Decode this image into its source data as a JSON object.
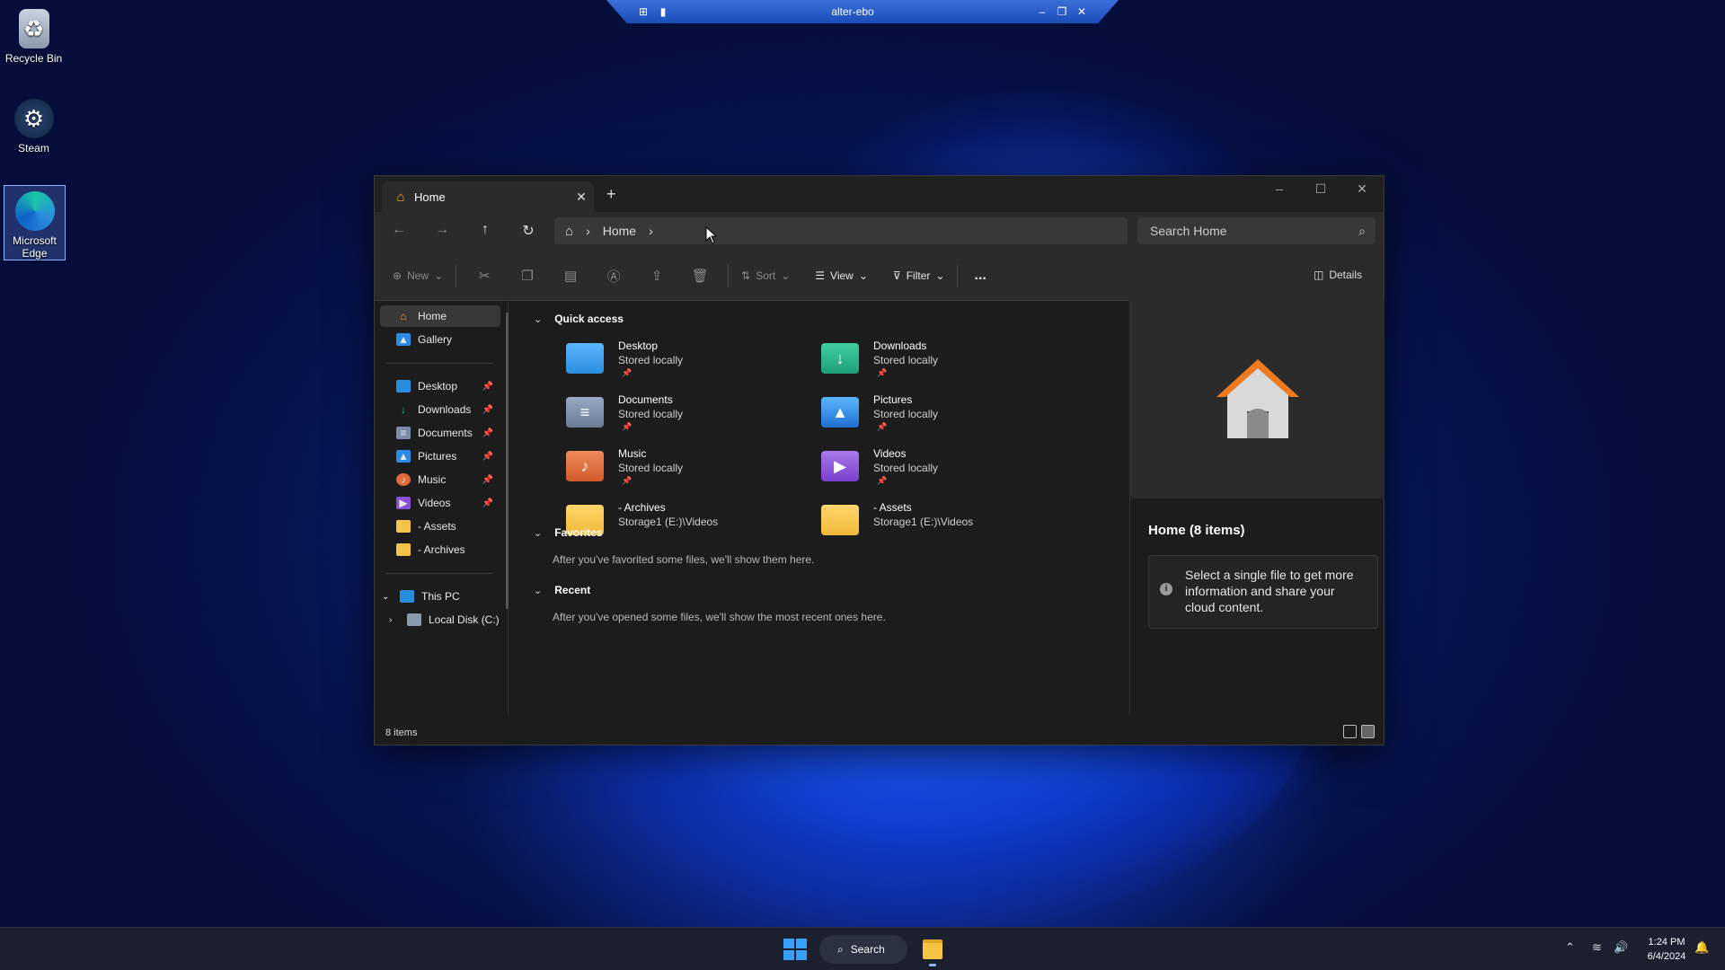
{
  "desktop": {
    "icons": [
      {
        "label": "Recycle Bin"
      },
      {
        "label": "Steam"
      },
      {
        "label": "Microsoft Edge"
      }
    ]
  },
  "remote_bar": {
    "title": "alter-ebo"
  },
  "explorer": {
    "tab_label": "Home",
    "new_tab": "+",
    "breadcrumb": [
      "Home"
    ],
    "search_placeholder": "Search Home",
    "toolbar": {
      "new": "New",
      "sort": "Sort",
      "view": "View",
      "filter": "Filter",
      "more": "...",
      "details": "Details"
    },
    "sidebar": {
      "top": [
        {
          "label": "Home",
          "selected": true
        },
        {
          "label": "Gallery"
        }
      ],
      "pinned": [
        {
          "label": "Desktop"
        },
        {
          "label": "Downloads"
        },
        {
          "label": "Documents"
        },
        {
          "label": "Pictures"
        },
        {
          "label": "Music"
        },
        {
          "label": "Videos"
        },
        {
          "label": "- Assets"
        },
        {
          "label": "- Archives"
        }
      ],
      "this_pc": "This PC",
      "local_disk": "Local Disk (C:)"
    },
    "sections": {
      "quick_access": "Quick access",
      "favorites": "Favorites",
      "favorites_note": "After you've favorited some files, we'll show them here.",
      "recent": "Recent",
      "recent_note": "After you've opened some files, we'll show the most recent ones here."
    },
    "quick_access_items": [
      {
        "name": "Desktop",
        "sub": "Stored locally",
        "color": "#2a8de0"
      },
      {
        "name": "Downloads",
        "sub": "Stored locally",
        "color": "#1f9e7a"
      },
      {
        "name": "Documents",
        "sub": "Stored locally",
        "color": "#7b8ca8"
      },
      {
        "name": "Pictures",
        "sub": "Stored locally",
        "color": "#2b8be6"
      },
      {
        "name": "Music",
        "sub": "Stored locally",
        "color": "#e06a3a"
      },
      {
        "name": "Videos",
        "sub": "Stored locally",
        "color": "#8a4fd6"
      },
      {
        "name": "- Archives",
        "sub": "Storage1 (E:)\\Videos",
        "color": "#f2c44a"
      },
      {
        "name": "- Assets",
        "sub": "Storage1 (E:)\\Videos",
        "color": "#f2c44a"
      }
    ],
    "details_pane": {
      "title": "Home (8 items)",
      "info": "Select a single file to get more information and share your cloud content."
    },
    "status": {
      "count": "8 items"
    }
  },
  "taskbar": {
    "search_label": "Search",
    "time": "1:24 PM",
    "date": "6/4/2024"
  }
}
